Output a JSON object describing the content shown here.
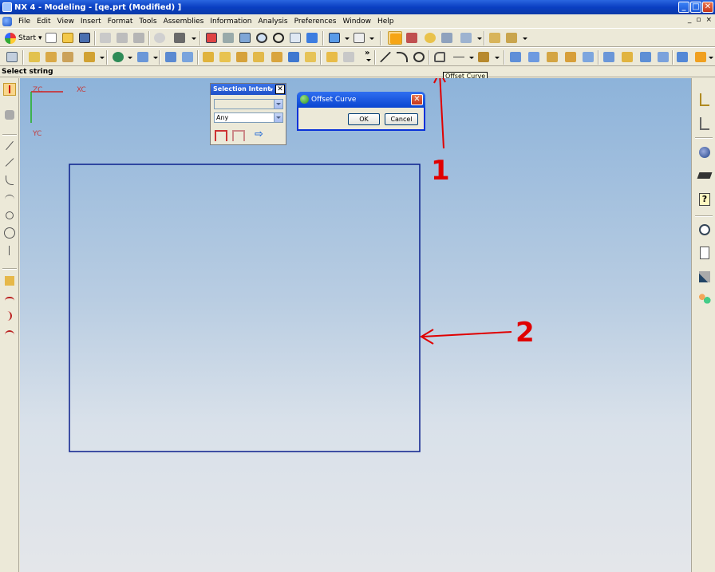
{
  "window": {
    "title": "NX 4 - Modeling - [qe.prt (Modified) ]",
    "minimize": "_",
    "maximize": "□",
    "close": "✕"
  },
  "menubar": {
    "items": [
      "File",
      "Edit",
      "View",
      "Insert",
      "Format",
      "Tools",
      "Assemblies",
      "Information",
      "Analysis",
      "Preferences",
      "Window",
      "Help"
    ],
    "doc_controls": [
      "_",
      "▫",
      "×"
    ]
  },
  "toolbar": {
    "start_label": "Start",
    "overflow_marker": "»"
  },
  "cue_line": {
    "prompt": "Select string"
  },
  "tooltip": {
    "text": "Offset Curve"
  },
  "wcs": {
    "zc": "ZC",
    "xc": "XC",
    "yc": "YC"
  },
  "selection_intent": {
    "title": "Selection Intent",
    "title_arrow": "▾",
    "close": "✕",
    "rule_value": "",
    "filter_value": "Any"
  },
  "offset_curve_dialog": {
    "title": "Offset Curve",
    "close": "✕",
    "ok_label": "OK",
    "cancel_label": "Cancel"
  },
  "annotations": [
    {
      "label": "1",
      "color": "#e00000"
    },
    {
      "label": "2",
      "color": "#e00000"
    }
  ],
  "colors": {
    "rectangle": "#0a1e8c",
    "xc_axis": "#d22020",
    "yc_axis": "#20b020",
    "title_bar": "#0a3fc2"
  }
}
